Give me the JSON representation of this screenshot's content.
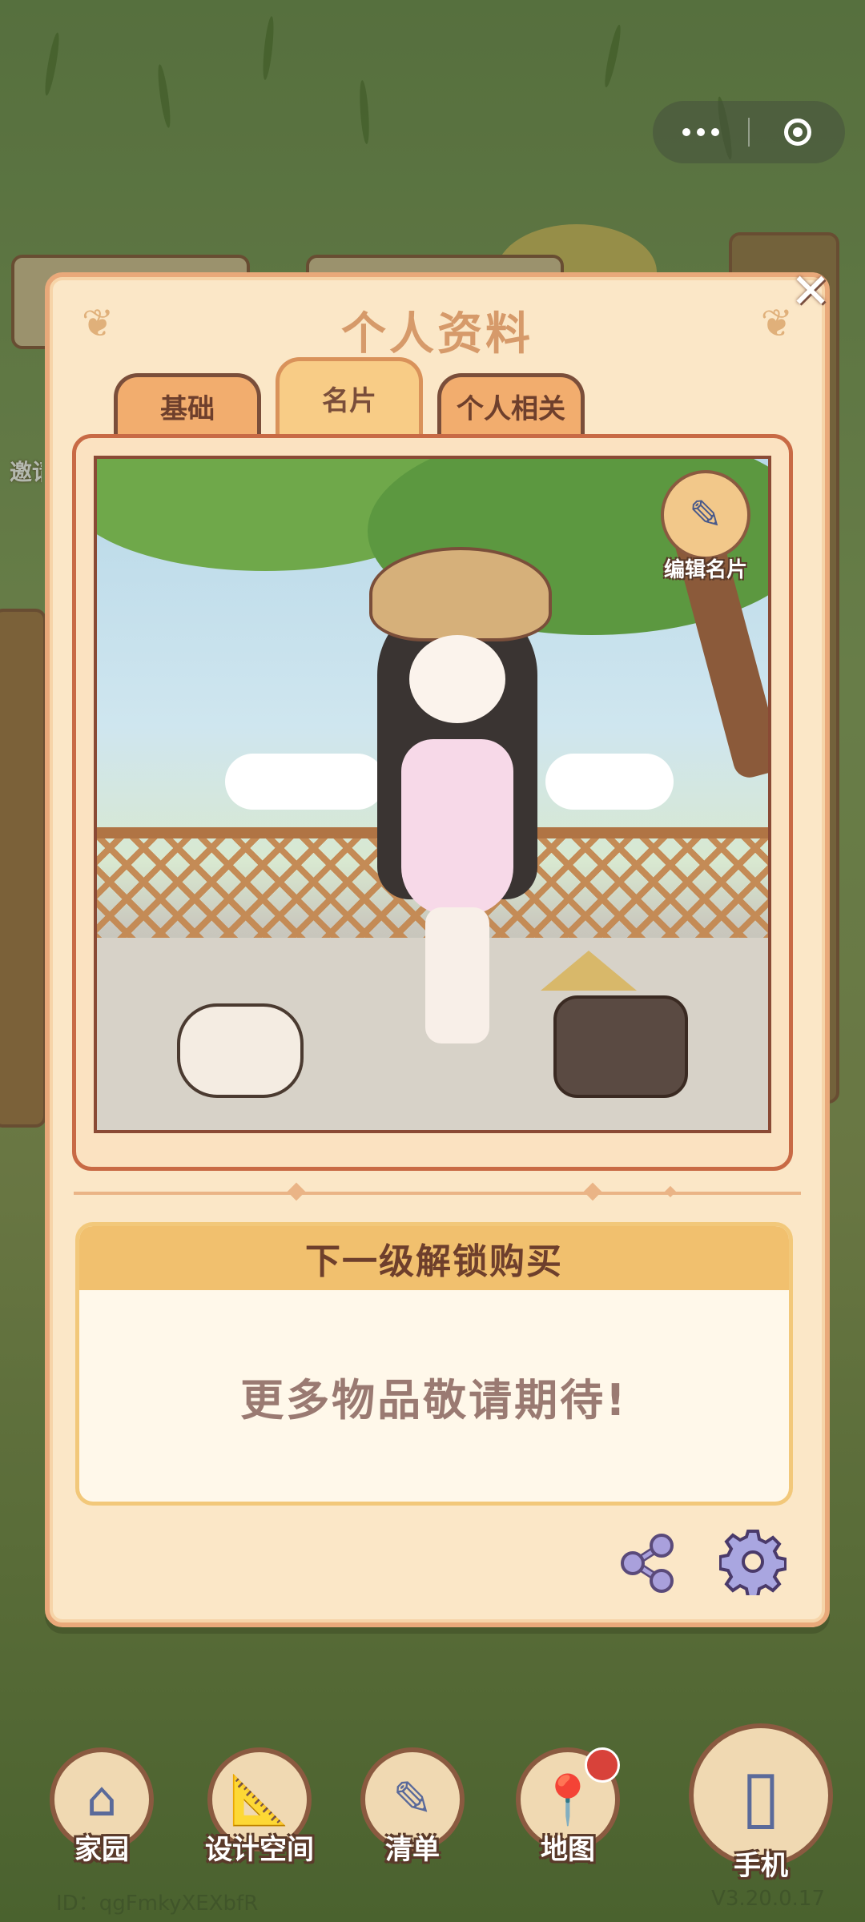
{
  "panel": {
    "title": "个人资料",
    "tabs": [
      {
        "label": "基础",
        "active": false
      },
      {
        "label": "名片",
        "active": true
      },
      {
        "label": "个人相关",
        "active": false
      }
    ],
    "edit_card_label": "编辑名片",
    "unlock": {
      "header": "下一级解锁购买",
      "body": "更多物品敬请期待!"
    }
  },
  "side": {
    "left_label": "邀请"
  },
  "bottom_nav": [
    {
      "label": "家园",
      "icon": "house-icon"
    },
    {
      "label": "设计空间",
      "icon": "design-ruler-icon"
    },
    {
      "label": "清单",
      "icon": "checklist-icon"
    },
    {
      "label": "地图",
      "icon": "map-pin-icon",
      "badge": true
    },
    {
      "label": "手机",
      "icon": "phone-icon"
    }
  ],
  "footer": {
    "uid": "ID：qgFmkyXEXbfR",
    "version": "V3.20.0.17"
  },
  "colors": {
    "panel_bg": "#fbe7c7",
    "tab_active": "#f8cc86",
    "tab_inactive": "#f2ad6e",
    "unlock_header": "#f1c06e",
    "accent_purple": "#8b89c6"
  }
}
